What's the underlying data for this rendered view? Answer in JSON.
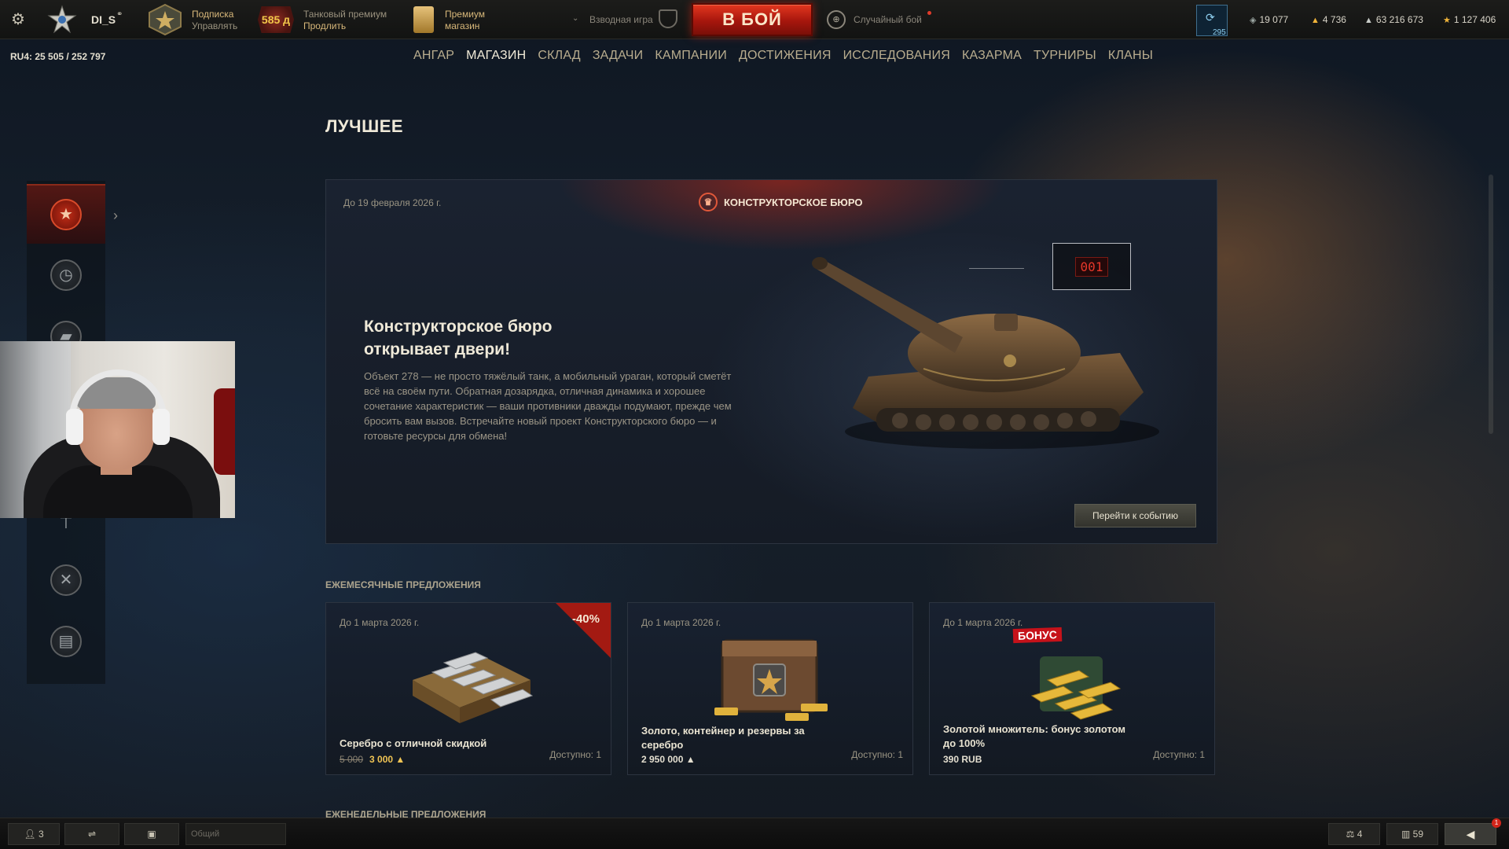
{
  "topbar": {
    "nickname": "DI_S",
    "subscription": {
      "line1": "Подписка",
      "line2": "Управлять"
    },
    "premium": {
      "days": "585 д",
      "line1": "Танковый премиум",
      "line2": "Продлить"
    },
    "shop": {
      "line1": "Премиум",
      "line2": "магазин"
    },
    "platoon_label": "Взводная игра",
    "battle_button": "В БОЙ",
    "battle_mode": "Случайный бой",
    "xp_count": "295",
    "currencies": {
      "free_xp": "19 077",
      "gold": "4 736",
      "credits": "63 216 673",
      "bonds": "1 127 406"
    }
  },
  "server": "RU4: 25 505 / 252 797",
  "nav": [
    "АНГАР",
    "МАГАЗИН",
    "СКЛАД",
    "ЗАДАЧИ",
    "КАМПАНИИ",
    "ДОСТИЖЕНИЯ",
    "ИССЛЕДОВАНИЯ",
    "КАЗАРМА",
    "ТУРНИРЫ",
    "КЛАНЫ"
  ],
  "nav_active": "МАГАЗИН",
  "sidebar_icons": [
    "star-icon",
    "clock-icon",
    "vehicle-icon",
    "research-icon",
    "tools-icon",
    "money-icon"
  ],
  "page_title": "ЛУЧШЕЕ",
  "hero": {
    "date": "До 19 февраля 2026 г.",
    "tag": "КОНСТРУКТОРСКОЕ БЮРО",
    "heading": "Конструкторское бюро открывает двери!",
    "description": "Объект 278 — не просто тяжёлый танк, а мобильный ураган, который сметёт всё на своём пути. Обратная дозарядка, отличная динамика и хорошее сочетание характеристик — ваши противники дважды подумают, прежде чем бросить вам вызов. Встречайте новый проект Конструкторского бюро — и готовьте ресурсы для обмена!",
    "counter": "001",
    "button": "Перейти к событию"
  },
  "monthly_label": "ЕЖЕМЕСЯЧНЫЕ ПРЕДЛОЖЕНИЯ",
  "weekly_label": "ЕЖЕНЕДЕЛЬНЫЕ ПРЕДЛОЖЕНИЯ",
  "offers": [
    {
      "date": "До 1 марта 2026 г.",
      "discount": "-40%",
      "title": "Серебро с отличной скидкой",
      "old_price": "5 000",
      "price": "3 000",
      "available": "Доступно: 1"
    },
    {
      "date": "До 1 марта 2026 г.",
      "title": "Золото, контейнер и резервы за серебро",
      "price": "2 950 000",
      "available": "Доступно: 1"
    },
    {
      "date": "До 1 марта 2026 г.",
      "badge": "БОНУС",
      "title": "Золотой множитель: бонус золотом до 100%",
      "price": "390 RUB",
      "available": "Доступно: 1"
    }
  ],
  "bottombar": {
    "friends": "3",
    "chat_placeholder": "Общий",
    "sessions": "4",
    "stats": "59",
    "notifications": "1"
  },
  "colors": {
    "battle_button": "#c4200f",
    "accent_gold": "#f0c454",
    "nav_text": "#b9ad8f"
  }
}
